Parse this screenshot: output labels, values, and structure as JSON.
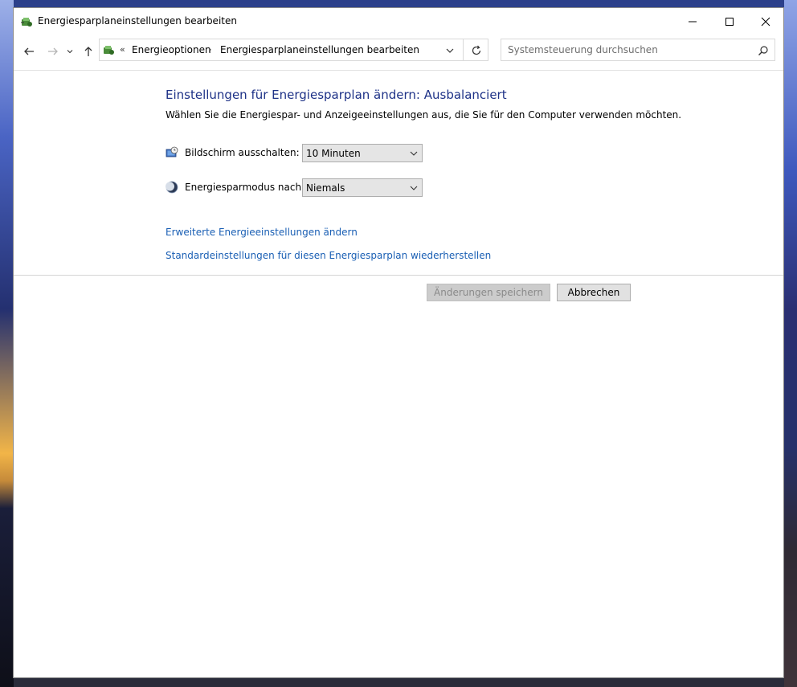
{
  "window": {
    "title": "Energiesparplaneinstellungen bearbeiten"
  },
  "address": {
    "separator": "«",
    "crumbs": [
      "Energieoptionen",
      "Energiesparplaneinstellungen bearbeiten"
    ],
    "crumb_arrow": "›"
  },
  "search": {
    "placeholder": "Systemsteuerung durchsuchen"
  },
  "main": {
    "heading": "Einstellungen für Energiesparplan ändern: Ausbalanciert",
    "description": "Wählen Sie die Energiespar- und Anzeigeeinstellungen aus, die Sie für den Computer verwenden möchten.",
    "settings": [
      {
        "label": "Bildschirm ausschalten:",
        "value": "10 Minuten",
        "icon": "monitor-clock-icon"
      },
      {
        "label": "Energiesparmodus nach:",
        "value": "Niemals",
        "icon": "moon-icon"
      }
    ],
    "links": [
      "Erweiterte Energieeinstellungen ändern",
      "Standardeinstellungen für diesen Energiesparplan wiederherstellen"
    ],
    "buttons": {
      "save": "Änderungen speichern",
      "cancel": "Abbrechen"
    }
  },
  "colors": {
    "heading": "#1e3287",
    "link": "#1a5fb4"
  }
}
